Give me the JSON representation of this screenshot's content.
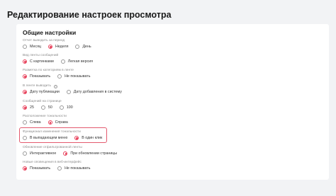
{
  "page": {
    "title": "Редактирование настроек просмотра"
  },
  "settings": {
    "title": "Общие настройки",
    "groups": [
      {
        "label": "Отчет выводить за период",
        "options": [
          "Месяц",
          "Неделя",
          "День"
        ],
        "selected": 1
      },
      {
        "label": "Вид ленты сообщений",
        "options": [
          "С картинками",
          "Легкая версия"
        ],
        "selected": 0
      },
      {
        "label": "Разметка по категориям в ленте",
        "options": [
          "Показывать",
          "Не показывать"
        ],
        "selected": 0
      },
      {
        "label": "В ленте выводить",
        "options": [
          "Дату публикации",
          "Дату добавления в систему"
        ],
        "selected": 0,
        "info_icon": "info-icon"
      },
      {
        "label": "Сообщений на странице",
        "options": [
          "25",
          "50",
          "100"
        ],
        "selected": 0
      },
      {
        "label": "Расположение тональности",
        "options": [
          "Слева",
          "Справа"
        ],
        "selected": 1
      },
      {
        "label": "Функционал изменения тональности",
        "options": [
          "В выпадающем меню",
          "В один клик"
        ],
        "selected": 1,
        "highlighted": true
      },
      {
        "label": "Обновление отфильтрованной ленты",
        "options": [
          "Интерактивное",
          "При обновлении страницы"
        ],
        "selected": 1
      },
      {
        "label": "Новые оповещения в веб-интерфейс",
        "options": [
          "Показывать",
          "Не показывать"
        ],
        "selected": 0
      }
    ]
  },
  "colors": {
    "accent": "#e8425c",
    "highlight_border": "#e35a6e",
    "background": "#f2f3f5"
  }
}
